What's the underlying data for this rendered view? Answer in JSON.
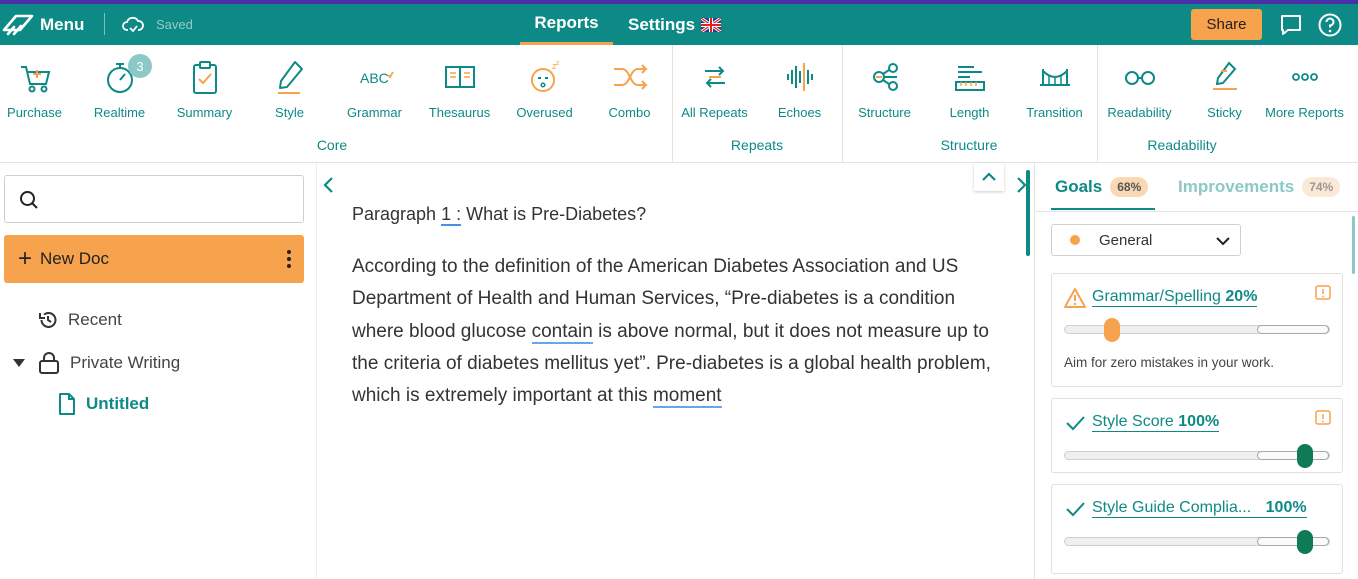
{
  "topbar": {
    "menu_label": "Menu",
    "saved_label": "Saved",
    "tabs": [
      {
        "label": "Reports",
        "active": true
      },
      {
        "label": "Settings",
        "active": false
      }
    ],
    "share_label": "Share",
    "icons": [
      "chat-icon",
      "help-icon"
    ],
    "accent_color": "#0e8a86",
    "highlight_color": "#f7a24d"
  },
  "toolbar": {
    "tools": [
      {
        "label": "Purchase",
        "icon": "cart-icon"
      },
      {
        "label": "Realtime",
        "icon": "stopwatch-icon",
        "badge": "3"
      },
      {
        "label": "Summary",
        "icon": "clipboard-icon"
      },
      {
        "label": "Style",
        "icon": "pen-icon"
      },
      {
        "label": "Grammar",
        "icon": "abc-icon"
      },
      {
        "label": "Thesaurus",
        "icon": "book-icon"
      },
      {
        "label": "Overused",
        "icon": "sleepy-face-icon"
      },
      {
        "label": "Combo",
        "icon": "shuffle-icon"
      },
      {
        "label": "All Repeats",
        "icon": "repeat-icon"
      },
      {
        "label": "Echoes",
        "icon": "soundwave-icon"
      },
      {
        "label": "Structure",
        "icon": "nodes-icon"
      },
      {
        "label": "Length",
        "icon": "ruler-icon"
      },
      {
        "label": "Transition",
        "icon": "bridge-icon"
      },
      {
        "label": "Readability",
        "icon": "glasses-icon"
      },
      {
        "label": "Sticky",
        "icon": "sticky-pen-icon"
      },
      {
        "label": "More Reports",
        "icon": "more-icon"
      }
    ],
    "groups": [
      {
        "label": "Core"
      },
      {
        "label": "Repeats"
      },
      {
        "label": "Structure"
      },
      {
        "label": "Readability"
      }
    ]
  },
  "sidebar": {
    "search_placeholder": "",
    "new_doc_label": "New Doc",
    "items": [
      {
        "label": "Recent",
        "icon": "history-icon"
      },
      {
        "label": "Private Writing",
        "icon": "lock-icon"
      },
      {
        "label": "Untitled",
        "icon": "document-icon"
      }
    ]
  },
  "editor": {
    "paragraph_prefix": "Paragraph ",
    "paragraph_number": "1",
    "paragraph_colon": " :",
    "paragraph_title": " What is Pre-Diabetes?",
    "body": {
      "part1": "According to the definition of the American Diabetes Association and US Department of Health and Human Services, “Pre-diabetes is a condition where blood glucose ",
      "flag1": "contain",
      "part2": " is above normal, but it does not measure up to the criteria of diabetes mellitus yet”. Pre-diabetes is a global health problem, which is extremely important at this ",
      "flag2": "moment"
    }
  },
  "right_panel": {
    "tabs": [
      {
        "label": "Goals",
        "pct": "68%"
      },
      {
        "label": "Improvements",
        "pct": "74%"
      }
    ],
    "filter_value": "General",
    "cards": [
      {
        "title": "Grammar/Spelling",
        "score": "20%",
        "score_value": 0.2,
        "icon": "warning-icon",
        "description": "Aim for zero mistakes in your work."
      },
      {
        "title": "Style Score",
        "score": "100%",
        "score_value": 1.0,
        "icon": "check-icon"
      },
      {
        "title": "Style Guide Complia...",
        "score": "100%",
        "score_value": 1.0,
        "icon": "check-icon"
      }
    ]
  }
}
